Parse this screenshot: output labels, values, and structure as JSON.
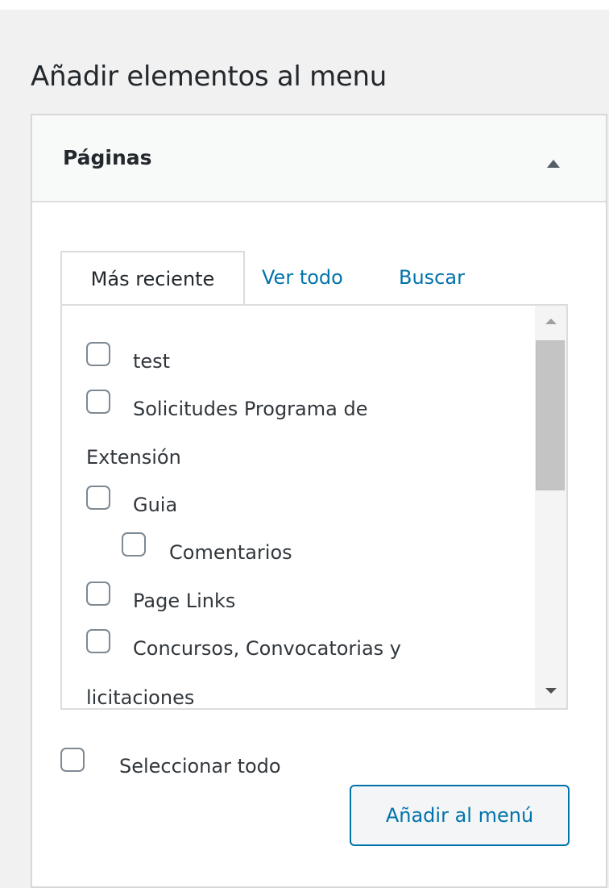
{
  "page": {
    "title": "Añadir elementos al menu"
  },
  "panel": {
    "title": "Páginas",
    "toggle_icon": "triangle-up-icon"
  },
  "tabs": [
    {
      "label": "Más reciente",
      "active": true
    },
    {
      "label": "Ver todo",
      "active": false
    },
    {
      "label": "Buscar",
      "active": false
    }
  ],
  "items": [
    {
      "label": "test",
      "level": 0,
      "checked": false
    },
    {
      "label": "Solicitudes Programa de",
      "continuation": "Extensión",
      "level": 0,
      "checked": false
    },
    {
      "label": "Guia",
      "level": 0,
      "checked": false
    },
    {
      "label": "Comentarios",
      "level": 1,
      "checked": false
    },
    {
      "label": "Page Links",
      "level": 0,
      "checked": false
    },
    {
      "label": "Concursos, Convocatorias y",
      "continuation": "licitaciones",
      "level": 0,
      "checked": false
    }
  ],
  "select_all": {
    "label": "Seleccionar todo",
    "checked": false
  },
  "add_button": {
    "label": "Añadir al menú"
  },
  "colors": {
    "background": "#f1f1f1",
    "panel_header": "#f8f9f9",
    "link": "#0073aa",
    "border": "#dcdcdc",
    "text": "#23282d"
  }
}
